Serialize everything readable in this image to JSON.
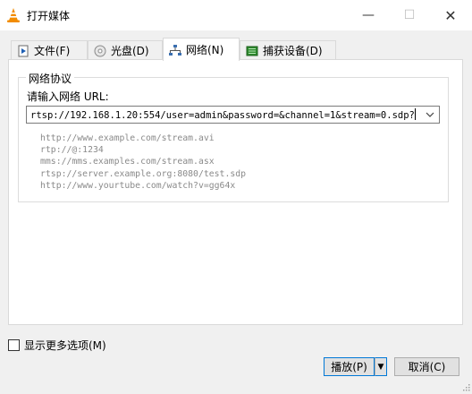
{
  "window": {
    "title": "打开媒体",
    "minimize_glyph": "—",
    "maximize_glyph": "☐",
    "close_glyph": "✕"
  },
  "tabs": [
    {
      "label": "文件(F)",
      "icon": "file-icon",
      "selected": false
    },
    {
      "label": "光盘(D)",
      "icon": "disc-icon",
      "selected": false
    },
    {
      "label": "网络(N)",
      "icon": "network-icon",
      "selected": true
    },
    {
      "label": "捕获设备(D)",
      "icon": "capture-device-icon",
      "selected": false
    }
  ],
  "network": {
    "group_title": "网络协议",
    "url_label": "请输入网络 URL:",
    "url_value": "rtsp://192.168.1.20:554/user=admin&password=&channel=1&stream=0.sdp?",
    "examples": [
      "http://www.example.com/stream.avi",
      "rtp://@:1234",
      "mms://mms.examples.com/stream.asx",
      "rtsp://server.example.org:8080/test.sdp",
      "http://www.yourtube.com/watch?v=gg64x"
    ]
  },
  "footer": {
    "more_options_label": "显示更多选项(M)",
    "more_options_checked": false,
    "play_label": "播放(P)",
    "cancel_label": "取消(C)"
  },
  "colors": {
    "accent": "#0078d7",
    "vlc_orange": "#f28c00"
  }
}
